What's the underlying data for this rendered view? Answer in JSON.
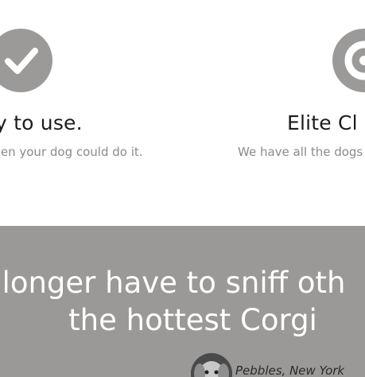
{
  "features": [
    {
      "icon": "checkmark-icon",
      "title": "y to use.",
      "description": "ven your dog could do it."
    },
    {
      "icon": "award-icon",
      "title": "Elite Cl",
      "description": "We have all the dogs"
    }
  ],
  "testimonial": {
    "quote_line1": "longer have to sniff oth",
    "quote_line2": "the hottest Corgi",
    "author": "Pebbles, New York",
    "avatar_icon": "dog-avatar"
  },
  "colors": {
    "icon_bg": "#9b9a99",
    "band_bg": "#9b9997"
  }
}
